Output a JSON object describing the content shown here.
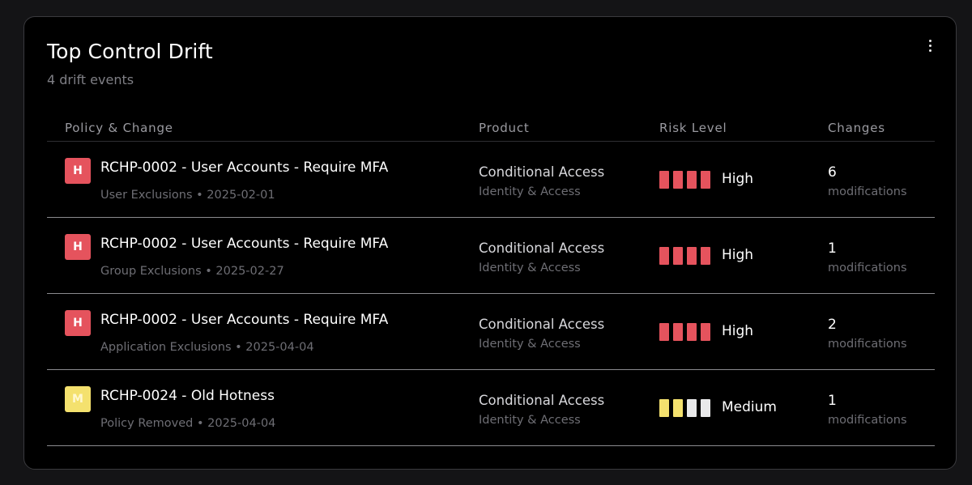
{
  "card": {
    "title": "Top Control Drift",
    "subtitle": "4 drift events",
    "menu_icon": "vertical-ellipsis-icon"
  },
  "columns": {
    "policy": "Policy & Change",
    "product": "Product",
    "risk": "Risk Level",
    "changes": "Changes"
  },
  "colors": {
    "high": "#e5535d",
    "medium": "#f4e16e",
    "bar_off": "#e9e9ea"
  },
  "rows": [
    {
      "badge": "H",
      "level": "high",
      "name": "RCHP-0002 - User Accounts - Require MFA",
      "detail": "User Exclusions • 2025-02-01",
      "product": "Conditional Access",
      "category": "Identity & Access",
      "risk": "High",
      "risk_level": 4,
      "changes": "6",
      "changes_label": "modifications"
    },
    {
      "badge": "H",
      "level": "high",
      "name": "RCHP-0002 - User Accounts - Require MFA",
      "detail": "Group Exclusions • 2025-02-27",
      "product": "Conditional Access",
      "category": "Identity & Access",
      "risk": "High",
      "risk_level": 4,
      "changes": "1",
      "changes_label": "modifications"
    },
    {
      "badge": "H",
      "level": "high",
      "name": "RCHP-0002 - User Accounts - Require MFA",
      "detail": "Application Exclusions • 2025-04-04",
      "product": "Conditional Access",
      "category": "Identity & Access",
      "risk": "High",
      "risk_level": 4,
      "changes": "2",
      "changes_label": "modifications"
    },
    {
      "badge": "M",
      "level": "medium",
      "name": "RCHP-0024 - Old Hotness",
      "detail": "Policy Removed • 2025-04-04",
      "product": "Conditional Access",
      "category": "Identity & Access",
      "risk": "Medium",
      "risk_level": 2,
      "changes": "1",
      "changes_label": "modifications"
    }
  ]
}
